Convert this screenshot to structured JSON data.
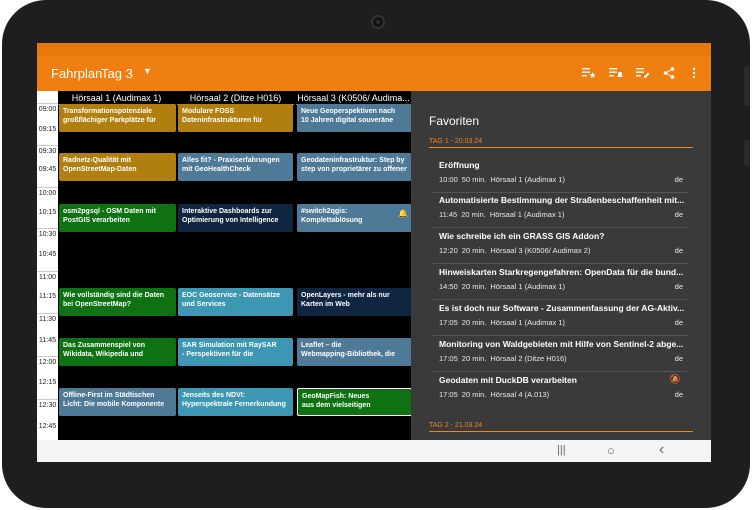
{
  "appbar": {
    "title": "Fahrplan",
    "day": "Tag 3",
    "caret": "▼",
    "icons": [
      "playlist-star-icon",
      "playlist-bell-icon",
      "playlist-edit-icon",
      "share-icon",
      "more-vert-icon"
    ]
  },
  "columns": [
    "Hörsaal 1 (Audimax 1)",
    "Hörsaal 2 (Ditze H016)",
    "Hörsaal 3 (K0506/ Audima..."
  ],
  "times": [
    "09:00",
    "09:15",
    "09:30",
    "09:45",
    "10:00",
    "10:15",
    "10:30",
    "10:45",
    "11:00",
    "11:15",
    "11:30",
    "11:45",
    "12:00",
    "12:15",
    "12:30",
    "12:45"
  ],
  "events": [
    {
      "l1": "Transformationspotenziale",
      "l2": "großflächiger Parkplätze für",
      "color": "#b07f0f"
    },
    {
      "l1": "Modulare FOSS",
      "l2": "Dateninfrastrukturen für",
      "color": "#b07f0f"
    },
    {
      "l1": "Neue Geoperspektiven nach",
      "l2": "10 Jahren digital souveräne",
      "color": "#4e7997"
    },
    {
      "l1": "Radnetz-Qualität mit",
      "l2": "OpenStreetMap-Daten",
      "color": "#b07f0f"
    },
    {
      "l1": "Alles fit? - Praxiserfahrungen",
      "l2": "mit GeoHealthCheck",
      "color": "#4e7997"
    },
    {
      "l1": "Geodateninfrastruktur: Step by",
      "l2": "step von proprietärer zu offener",
      "color": "#4e7997"
    },
    {
      "l1": "osm2pgsql - OSM Daten mit",
      "l2": "PostGIS verarbeiten",
      "color": "#0e7212"
    },
    {
      "l1": "Interaktive Dashboards zur",
      "l2": "Optimierung von Intelligence",
      "color": "#0f2540"
    },
    {
      "l1": "#switch2qgis:",
      "l2": "Komplettablösung",
      "color": "#4e7997"
    },
    {
      "l1": "Wie vollständig sind die Daten",
      "l2": "bei OpenStreetMap?",
      "color": "#0e7212"
    },
    {
      "l1": "EOC Geoservice - Datensätze",
      "l2": "und Services",
      "color": "#3d97b2"
    },
    {
      "l1": "OpenLayers - mehr als nur",
      "l2": "Karten im Web",
      "color": "#0f2540"
    },
    {
      "l1": "Das Zusammenspiel von",
      "l2": "Wikidata, Wikipedia und",
      "color": "#0e7212"
    },
    {
      "l1": "SAR Simulation mit RaySAR",
      "l2": "- Perspektiven für die",
      "color": "#3d97b2"
    },
    {
      "l1": "Leaflet – die",
      "l2": "Webmapping-Bibliothek, die",
      "color": "#4e7997"
    },
    {
      "l1": "Offline-First im Städtischen",
      "l2": "Licht: Die mobile Komponente",
      "color": "#4e7997"
    },
    {
      "l1": "Jenseits des NDVI:",
      "l2": "Hyperspektrale Fernerkundung",
      "color": "#3d97b2"
    },
    {
      "l1": "GeoMapFish: Neues",
      "l2": "aus dem vielseitigen",
      "color": "#0e7212"
    }
  ],
  "favorites": {
    "title": "Favoriten",
    "day1": "TAG 1 - 20.03.24",
    "day2": "TAG 2 - 21.03.24",
    "items": [
      {
        "title": "Eröffnung",
        "time": "10:00",
        "dur": "50 min.",
        "room": "Hörsaal 1 (Audimax 1)",
        "lang": "de"
      },
      {
        "title": "Automatisierte Bestimmung der Straßenbeschaffenheit mit...",
        "time": "11:45",
        "dur": "20 min.",
        "room": "Hörsaal 1 (Audimax 1)",
        "lang": "de"
      },
      {
        "title": "Wie schreibe ich ein GRASS GIS Addon?",
        "time": "12:20",
        "dur": "20 min.",
        "room": "Hörsaal 3 (K0506/ Audimax 2)",
        "lang": "de"
      },
      {
        "title": "Hinweiskarten Starkregengefahren: OpenData für die bund...",
        "time": "14:50",
        "dur": "20 min.",
        "room": "Hörsaal 1 (Audimax 1)",
        "lang": "de"
      },
      {
        "title": "Es ist doch nur Software - Zusammenfassung der AG-Aktiv...",
        "time": "17:05",
        "dur": "20 min.",
        "room": "Hörsaal 1 (Audimax 1)",
        "lang": "de"
      },
      {
        "title": "Monitoring von Waldgebieten mit Hilfe von Sentinel-2 abge...",
        "time": "17:05",
        "dur": "20 min.",
        "room": "Hörsaal 2 (Ditze H016)",
        "lang": "de"
      },
      {
        "title": "Geodaten mit DuckDB verarbeiten",
        "time": "17:05",
        "dur": "20 min.",
        "room": "Hörsaal 4 (A.013)",
        "lang": "de"
      }
    ]
  },
  "navbar": {
    "recents": "|||",
    "home": "○",
    "back": "‹"
  }
}
